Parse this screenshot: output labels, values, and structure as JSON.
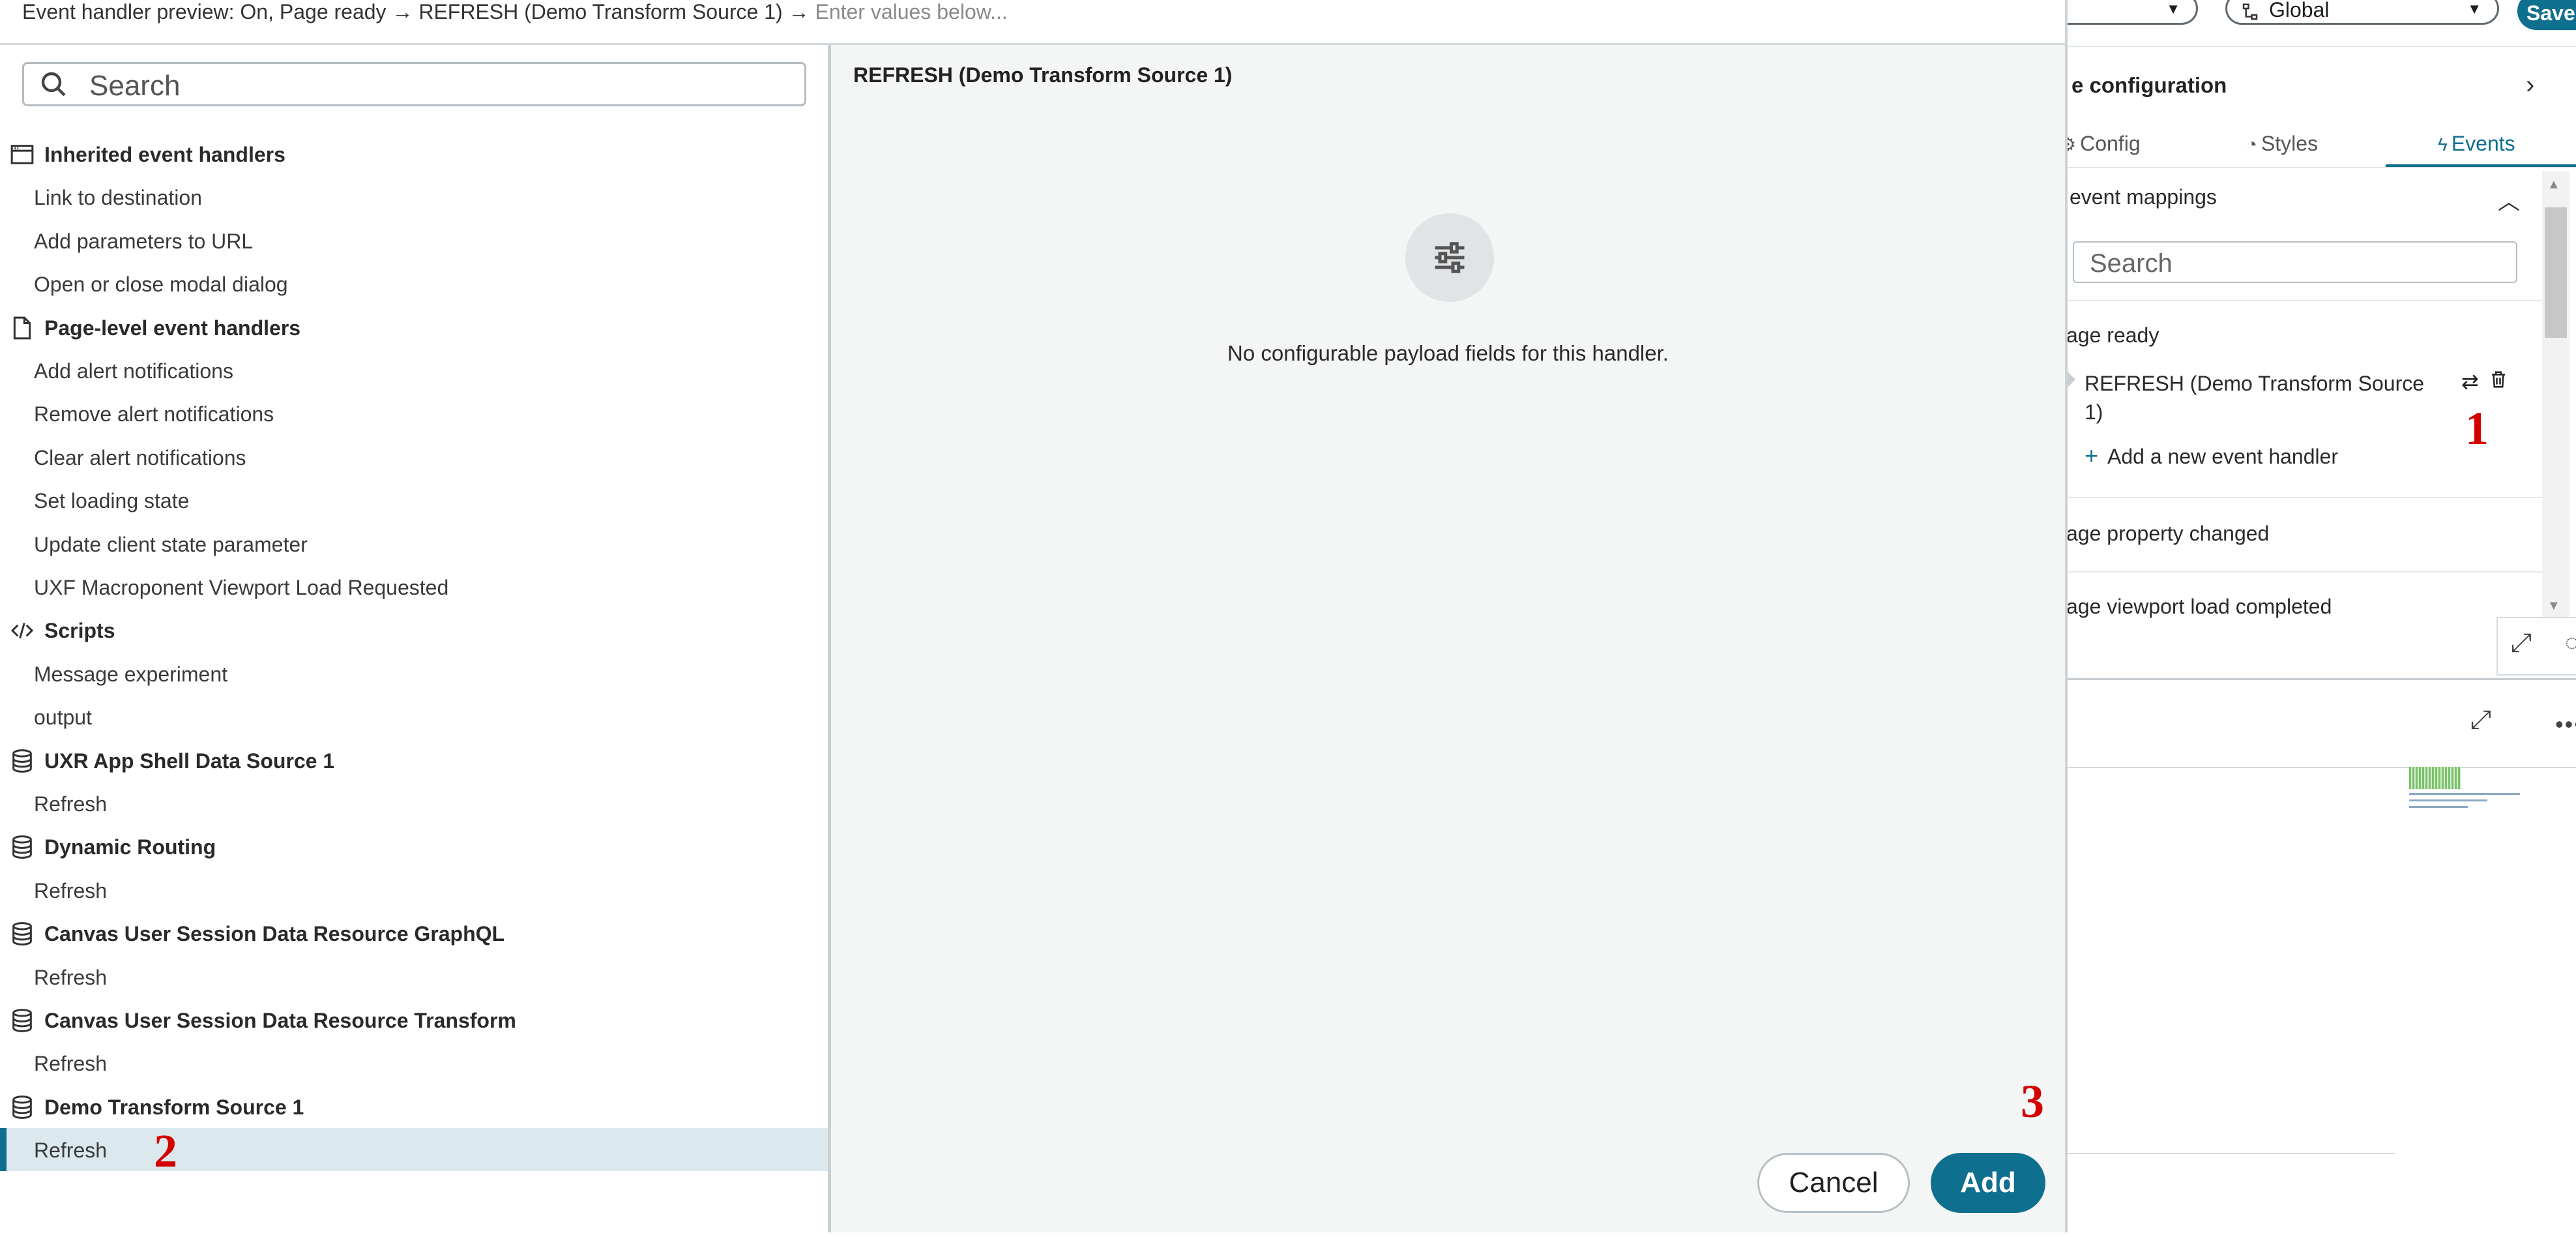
{
  "preview": {
    "prefix": "Event handler preview: ",
    "text": "On, Page ready → REFRESH (Demo Transform Source 1) → ",
    "placeholder": "Enter values below..."
  },
  "left_panel": {
    "search_placeholder": "Search",
    "rows": [
      {
        "type": "header",
        "icon": "window-icon",
        "label": "Inherited event handlers"
      },
      {
        "type": "item",
        "label": "Link to destination"
      },
      {
        "type": "item",
        "label": "Add parameters to URL"
      },
      {
        "type": "item",
        "label": "Open or close modal dialog"
      },
      {
        "type": "header",
        "icon": "page-icon",
        "label": "Page-level event handlers"
      },
      {
        "type": "item",
        "label": "Add alert notifications"
      },
      {
        "type": "item",
        "label": "Remove alert notifications"
      },
      {
        "type": "item",
        "label": "Clear alert notifications"
      },
      {
        "type": "item",
        "label": "Set loading state"
      },
      {
        "type": "item",
        "label": "Update client state parameter"
      },
      {
        "type": "item",
        "label": "UXF Macroponent Viewport Load Requested"
      },
      {
        "type": "header",
        "icon": "code-icon",
        "label": "Scripts"
      },
      {
        "type": "item",
        "label": "Message experiment"
      },
      {
        "type": "item",
        "label": "output"
      },
      {
        "type": "header",
        "icon": "database-icon",
        "label": "UXR App Shell Data Source 1"
      },
      {
        "type": "item",
        "label": "Refresh"
      },
      {
        "type": "header",
        "icon": "database-icon",
        "label": "Dynamic Routing"
      },
      {
        "type": "item",
        "label": "Refresh"
      },
      {
        "type": "header",
        "icon": "database-icon",
        "label": "Canvas User Session Data Resource GraphQL"
      },
      {
        "type": "item",
        "label": "Refresh"
      },
      {
        "type": "header",
        "icon": "database-icon",
        "label": "Canvas User Session Data Resource Transform"
      },
      {
        "type": "item",
        "label": "Refresh"
      },
      {
        "type": "header",
        "icon": "database-icon",
        "label": "Demo Transform Source 1"
      },
      {
        "type": "item",
        "label": "Refresh",
        "selected": true
      }
    ]
  },
  "right_panel": {
    "title": "REFRESH (Demo Transform Source 1)",
    "empty_message": "No configurable payload fields for this handler."
  },
  "footer": {
    "cancel_label": "Cancel",
    "add_label": "Add"
  },
  "markers": {
    "m1": "1",
    "m2": "2",
    "m3": "3"
  },
  "background_panel": {
    "select1_value": "",
    "scope_icon": "hierarchy-icon",
    "scope_value": "Global",
    "save_label": "Save",
    "section_title": "e configuration",
    "tabs": {
      "config": "Config",
      "styles": "Styles",
      "events": "Events"
    },
    "mappings_label": "event mappings",
    "search_placeholder": "Search",
    "page_ready_label": "age ready",
    "handler_item": "REFRESH (Demo Transform Source 1)",
    "add_handler_label": "Add a new event handler",
    "property_changed_label": "age property changed",
    "viewport_loaded_label": "age viewport load completed"
  },
  "colors": {
    "accent": "#0f6f8e",
    "selected_row": "#dbe9ee",
    "marker": "#d40000"
  }
}
